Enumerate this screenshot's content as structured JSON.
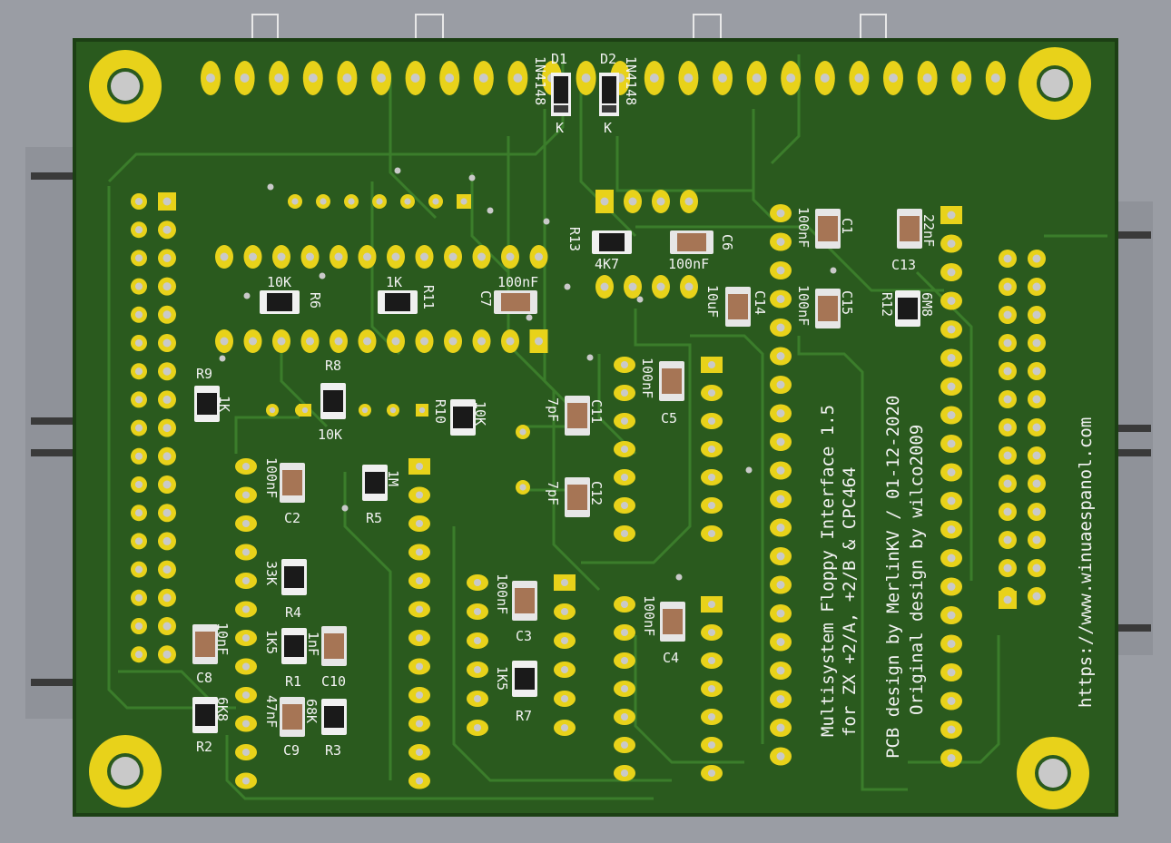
{
  "colors": {
    "background": "#9a9da4",
    "board": "#2a5a1e",
    "board_edge": "#1c3f14",
    "trace": "#3a7a2a",
    "pad": "#e8d21a",
    "hole": "#c9c9c9",
    "silk": "#f2f2f2",
    "connector": "#3a3a3a"
  },
  "labels": {
    "d1": "D1",
    "d2": "D2",
    "d1_value": "1N4148",
    "d2_value": "1N4148",
    "d1_k": "K",
    "d2_k": "K",
    "r13": "R13",
    "r13_value": "4K7",
    "c6": "C6",
    "c6_value": "100nF",
    "c1": "C1",
    "c1_value": "100nF",
    "c13": "C13",
    "c13_value": "22nF",
    "r6": "R6",
    "r6_value": "10K",
    "r11": "R11",
    "r11_value": "1K",
    "c7": "C7",
    "c7_value": "100nF",
    "c14": "C14",
    "c14_value": "10uF",
    "c15": "C15",
    "c15_value": "100nF",
    "r12": "R12",
    "r12_value": "6M8",
    "r9": "R9",
    "r9_value": "1K",
    "r8": "R8",
    "r8_value": "10K",
    "r10": "R10",
    "r10_value": "10K",
    "c5": "C5",
    "c5_value": "100nF",
    "c11": "C11",
    "c11_value": "7pF",
    "c12": "C12",
    "c12_value": "7pF",
    "c2": "C2",
    "c2_value": "100nF",
    "r5": "R5",
    "r5_value": "1M",
    "r4": "R4",
    "r4_value": "33K",
    "c3": "C3",
    "c3_value": "100nF",
    "c4": "C4",
    "c4_value": "100nF",
    "c8": "C8",
    "c8_value": "10nF",
    "r1": "R1",
    "r1_value": "1K5",
    "c10": "C10",
    "c10_value": "1nF",
    "r7": "R7",
    "r7_value": "1K5",
    "r2": "R2",
    "r2_value": "6K8",
    "c9": "C9",
    "c9_value": "47nF",
    "r3": "R3",
    "r3_value": "68K"
  },
  "board_text": {
    "line1": "Multisystem Floppy Interface 1.5",
    "line2": "for ZX +2/A, +2/B & CPC464",
    "line3": "PCB design by MerlinKV / 01-12-2020",
    "line4": "Original design by wilco2009",
    "url": "https://www.winuaespanol.com"
  }
}
